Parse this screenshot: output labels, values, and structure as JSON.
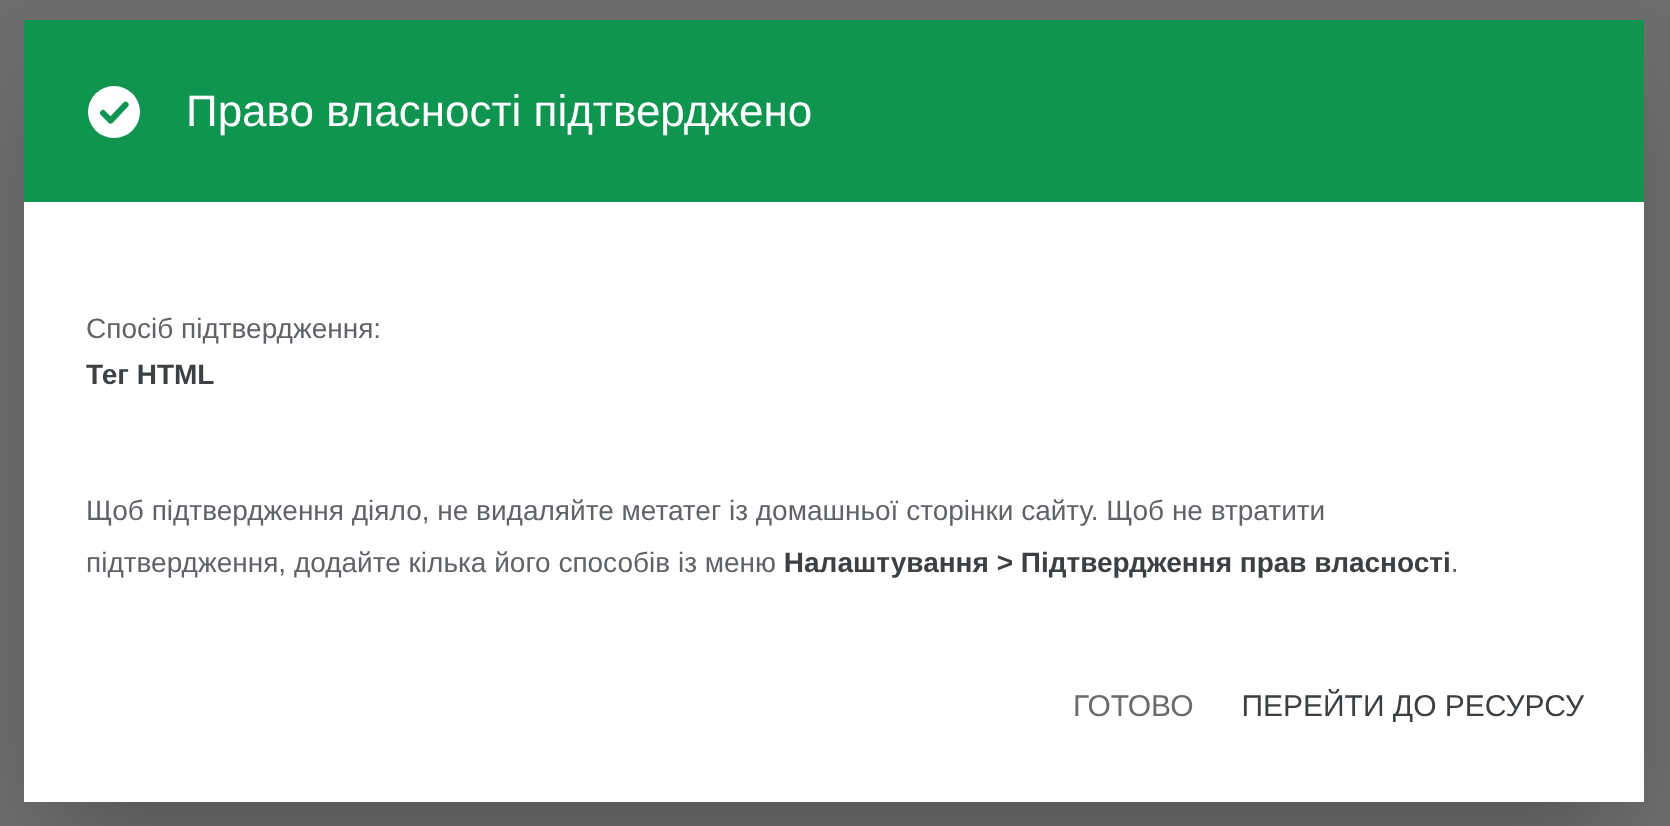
{
  "dialog": {
    "title": "Право власності підтверджено",
    "method_label": "Спосіб підтвердження:",
    "method_value": "Тег HTML",
    "message": "Щоб підтвердження діяло, не видаляйте метатег із домашньої сторінки сайту. Щоб не втратити підтвердження, додайте кілька його способів із меню **Налаштування > Підтвердження прав власності**.",
    "buttons": [
      {
        "label": "ГОТОВО",
        "kind": "secondary"
      },
      {
        "label": "ПЕРЕЙТИ ДО РЕСУРСУ",
        "kind": "primary"
      }
    ]
  }
}
